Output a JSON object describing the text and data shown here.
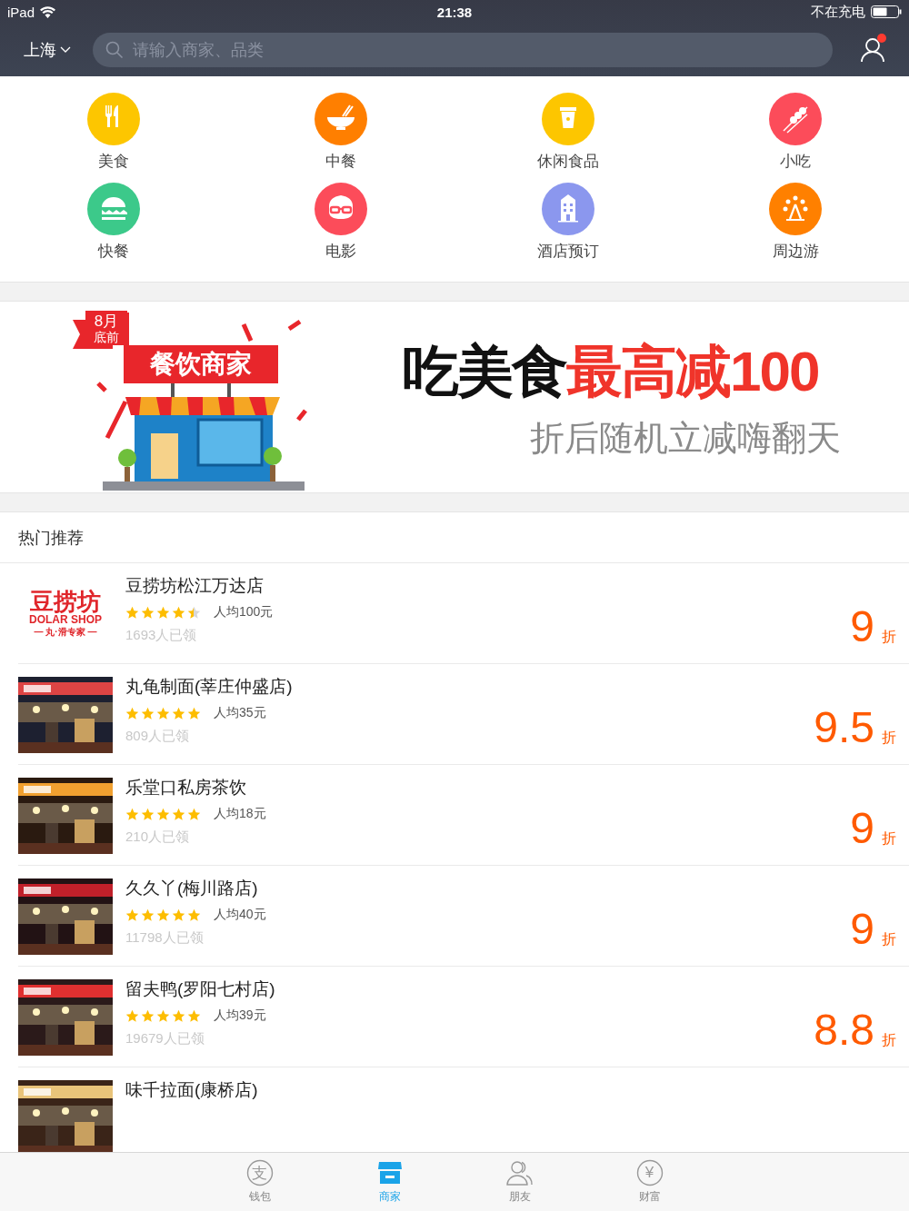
{
  "status_bar": {
    "device": "iPad",
    "time": "21:38",
    "battery_status": "不在充电"
  },
  "nav": {
    "city": "上海",
    "search": {
      "placeholder": "请输入商家、品类"
    },
    "notification": true
  },
  "categories": [
    {
      "label": "美食",
      "color": "#fdc600"
    },
    {
      "label": "中餐",
      "color": "#ff7f00"
    },
    {
      "label": "休闲食品",
      "color": "#fdc600"
    },
    {
      "label": "小吃",
      "color": "#fc4c5a"
    },
    {
      "label": "快餐",
      "color": "#3cc98a"
    },
    {
      "label": "电影",
      "color": "#fc4c5a"
    },
    {
      "label": "酒店预订",
      "color": "#8b97ee"
    },
    {
      "label": "周边游",
      "color": "#ff8000"
    }
  ],
  "banner": {
    "tag": [
      "8月",
      "底前"
    ],
    "sign": "餐饮商家",
    "title": "吃美食",
    "highlight": "最高减100",
    "subtitle": "折后随机立减嗨翻天"
  },
  "section_title": "热门推荐",
  "shops": [
    {
      "kind": "logo",
      "logo": [
        "豆捞坊",
        "DOLAR SHOP",
        "— 丸·滑专家 —"
      ],
      "name": "豆捞坊松江万达店",
      "stars": 4.5,
      "price": "人均100元",
      "claimed": "1693人已领",
      "discount": "9",
      "unit": "折"
    },
    {
      "kind": "picture",
      "name": "丸龟制面(莘庄仲盛店)",
      "stars": 5,
      "price": "人均35元",
      "claimed": "809人已领",
      "discount": "9.5",
      "unit": "折"
    },
    {
      "kind": "picture",
      "name": "乐堂口私房茶饮",
      "stars": 5,
      "price": "人均18元",
      "claimed": "210人已领",
      "discount": "9",
      "unit": "折"
    },
    {
      "kind": "picture",
      "name": "久久丫(梅川路店)",
      "stars": 5,
      "price": "人均40元",
      "claimed": "11798人已领",
      "discount": "9",
      "unit": "折"
    },
    {
      "kind": "picture",
      "name": "留夫鸭(罗阳七村店)",
      "stars": 5,
      "price": "人均39元",
      "claimed": "19679人已领",
      "discount": "8.8",
      "unit": "折"
    },
    {
      "kind": "picture",
      "name": "味千拉面(康桥店)"
    }
  ],
  "tabs": [
    {
      "label": "钱包",
      "icon_text": "支",
      "selected": false
    },
    {
      "label": "商家",
      "selected": true
    },
    {
      "label": "朋友",
      "selected": false
    },
    {
      "label": "财富",
      "icon_text": "¥",
      "selected": false
    }
  ]
}
